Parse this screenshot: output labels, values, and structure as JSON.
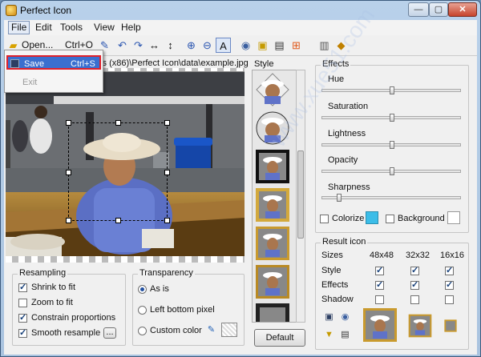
{
  "window": {
    "title": "Perfect Icon",
    "minimize": "—",
    "maximize": "▢",
    "close": "✕"
  },
  "menu": {
    "items": [
      "File",
      "Edit",
      "Tools",
      "View",
      "Help"
    ]
  },
  "file_menu": {
    "open": {
      "label": "Open...",
      "shortcut": "Ctrl+O"
    },
    "save": {
      "label": "Save",
      "shortcut": "Ctrl+S"
    },
    "exit": {
      "label": "Exit"
    }
  },
  "toolbar": {
    "icons": [
      "open-icon",
      "color-picker-icon",
      "undo-icon",
      "redo-icon",
      "flip-horizontal-icon",
      "flip-vertical-icon",
      "zoom-in-icon",
      "zoom-out-icon",
      "auto-fit-icon",
      "preview-eye-icon",
      "favicon-icon",
      "windows-exe-icon",
      "windows-logo-icon",
      "library-icon",
      "help-book-icon"
    ]
  },
  "path_text": "les (x86)\\Perfect Icon\\data\\example.jpg",
  "style": {
    "label": "Style",
    "default_button": "Default"
  },
  "resampling": {
    "label": "Resampling",
    "options": [
      {
        "label": "Shrink to fit",
        "checked": true
      },
      {
        "label": "Zoom to fit",
        "checked": false
      },
      {
        "label": "Constrain proportions",
        "checked": true
      },
      {
        "label": "Smooth resample",
        "checked": true
      }
    ],
    "more_button": "..."
  },
  "transparency": {
    "label": "Transparency",
    "options": [
      {
        "label": "As is",
        "selected": true
      },
      {
        "label": "Left bottom pixel",
        "selected": false
      },
      {
        "label": "Custom color",
        "selected": false
      }
    ]
  },
  "effects": {
    "label": "Effects",
    "sliders": [
      {
        "label": "Hue",
        "value": 0.5
      },
      {
        "label": "Saturation",
        "value": 0.5
      },
      {
        "label": "Lightness",
        "value": 0.5
      },
      {
        "label": "Opacity",
        "value": 0.5
      },
      {
        "label": "Sharpness",
        "value": 0.1
      }
    ],
    "colorize": {
      "label": "Colorize",
      "checked": false,
      "color": "#3cbde8"
    },
    "background": {
      "label": "Background",
      "checked": false,
      "color": "#ffffff"
    }
  },
  "result": {
    "label": "Result icon",
    "columns": [
      "Sizes",
      "48x48",
      "32x32",
      "16x16"
    ],
    "rows": [
      {
        "label": "Style",
        "values": [
          true,
          true,
          true
        ]
      },
      {
        "label": "Effects",
        "values": [
          true,
          true,
          true
        ]
      },
      {
        "label": "Shadow",
        "values": [
          false,
          false,
          false
        ]
      }
    ]
  },
  "watermark": "www.xue51.com"
}
